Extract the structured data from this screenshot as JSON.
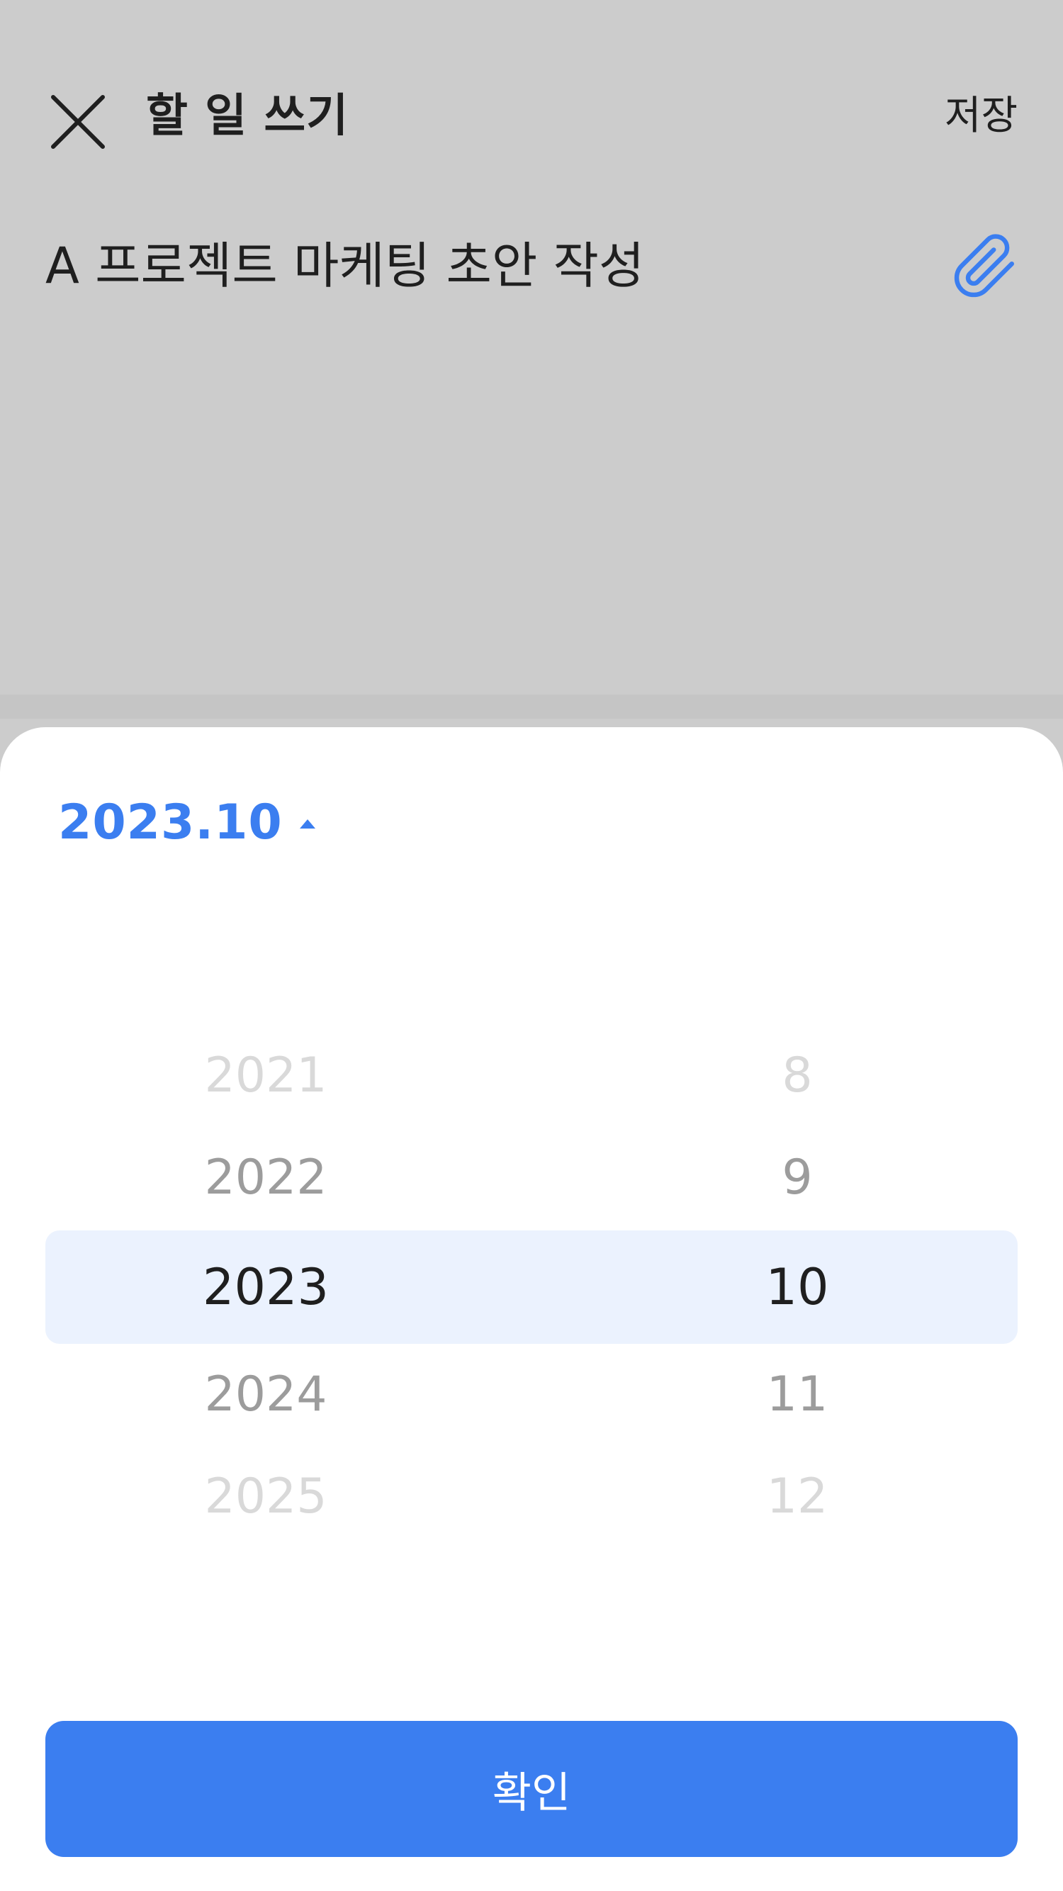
{
  "header": {
    "close_icon": "close-icon",
    "title": "할 일 쓰기",
    "save_label": "저장"
  },
  "editor": {
    "task_title": "A 프로젝트 마케팅 초안 작성",
    "attach_icon": "paperclip-icon",
    "attach_color": "#3b7ef0"
  },
  "sheet": {
    "current_month_label": "2023.10",
    "toggle_icon": "caret-up-icon",
    "accent_color": "#3b7ef0",
    "picker": {
      "years": [
        "2021",
        "2022",
        "2023",
        "2024",
        "2025"
      ],
      "months": [
        "8",
        "9",
        "10",
        "11",
        "12"
      ],
      "selected_year": "2023",
      "selected_month": "10"
    },
    "confirm_label": "확인"
  }
}
